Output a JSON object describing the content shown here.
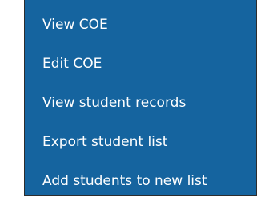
{
  "context_menu": {
    "items": [
      {
        "label": "View COE"
      },
      {
        "label": "Edit COE"
      },
      {
        "label": "View student records"
      },
      {
        "label": "Export student list"
      },
      {
        "label": "Add students to new list"
      }
    ]
  },
  "colors": {
    "menu_background": "#15649f",
    "menu_text": "#ffffff",
    "menu_border": "#2d2d2d"
  }
}
